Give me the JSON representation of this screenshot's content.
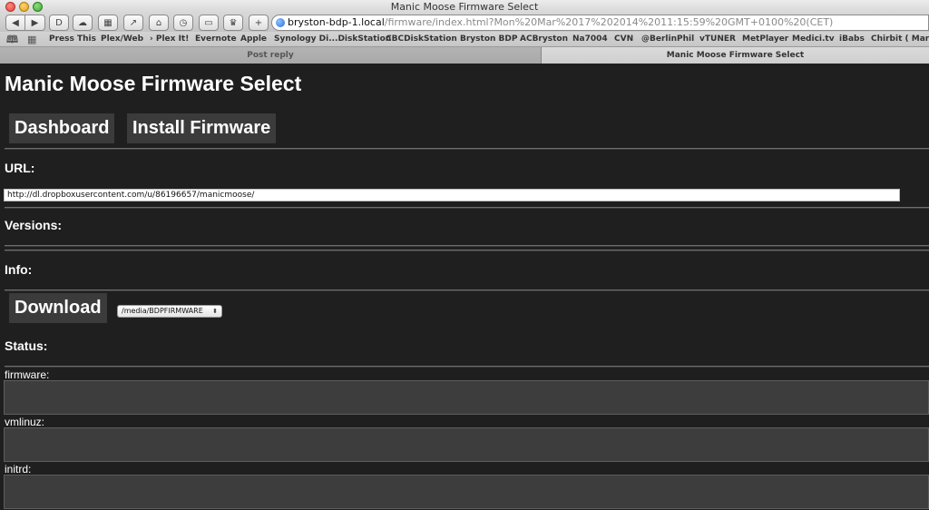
{
  "window": {
    "title": "Manic Moose Firmware Select"
  },
  "toolbar": {
    "back_icon": "back-arrow-icon",
    "forward_icon": "forward-arrow-icon",
    "add_label": "+",
    "address_host": "bryston-bdp-1.local",
    "address_path": "/firmware/index.html?Mon%20Mar%2017%202014%2011:15:59%20GMT+0100%20(CET)"
  },
  "bookmarks": [
    "Press This",
    "Plex/Web",
    "Plex It!",
    "Evernote",
    "Apple",
    "Synology Di...DiskStation",
    "CBCDiskStation",
    "Bryston BDP",
    "ACBryston",
    "Na7004",
    "CVN",
    "@BerlinPhil",
    "vTUNER",
    "MetPlayer",
    "Medici.tv",
    "iBabs",
    "Chirbit ( Marij"
  ],
  "tabs": [
    {
      "label": "Post reply",
      "active": false
    },
    {
      "label": "Manic Moose Firmware Select",
      "active": true
    }
  ],
  "page": {
    "title": "Manic Moose Firmware Select",
    "nav": {
      "dashboard": "Dashboard",
      "install": "Install Firmware"
    },
    "url_label": "URL:",
    "url_value": "http://dl.dropboxusercontent.com/u/86196657/manicmoose/",
    "versions_label": "Versions:",
    "info_label": "Info:",
    "download_label": "Download",
    "target_select": "/media/BDPFIRMWARE",
    "status_label": "Status:",
    "fields": {
      "firmware": "firmware:",
      "vmlinuz": "vmlinuz:",
      "initrd": "initrd:"
    }
  },
  "colors": {
    "page_bg": "#1f1f1f",
    "button_bg": "#3b3b3b",
    "textbox_bg": "#3d3d3d"
  }
}
